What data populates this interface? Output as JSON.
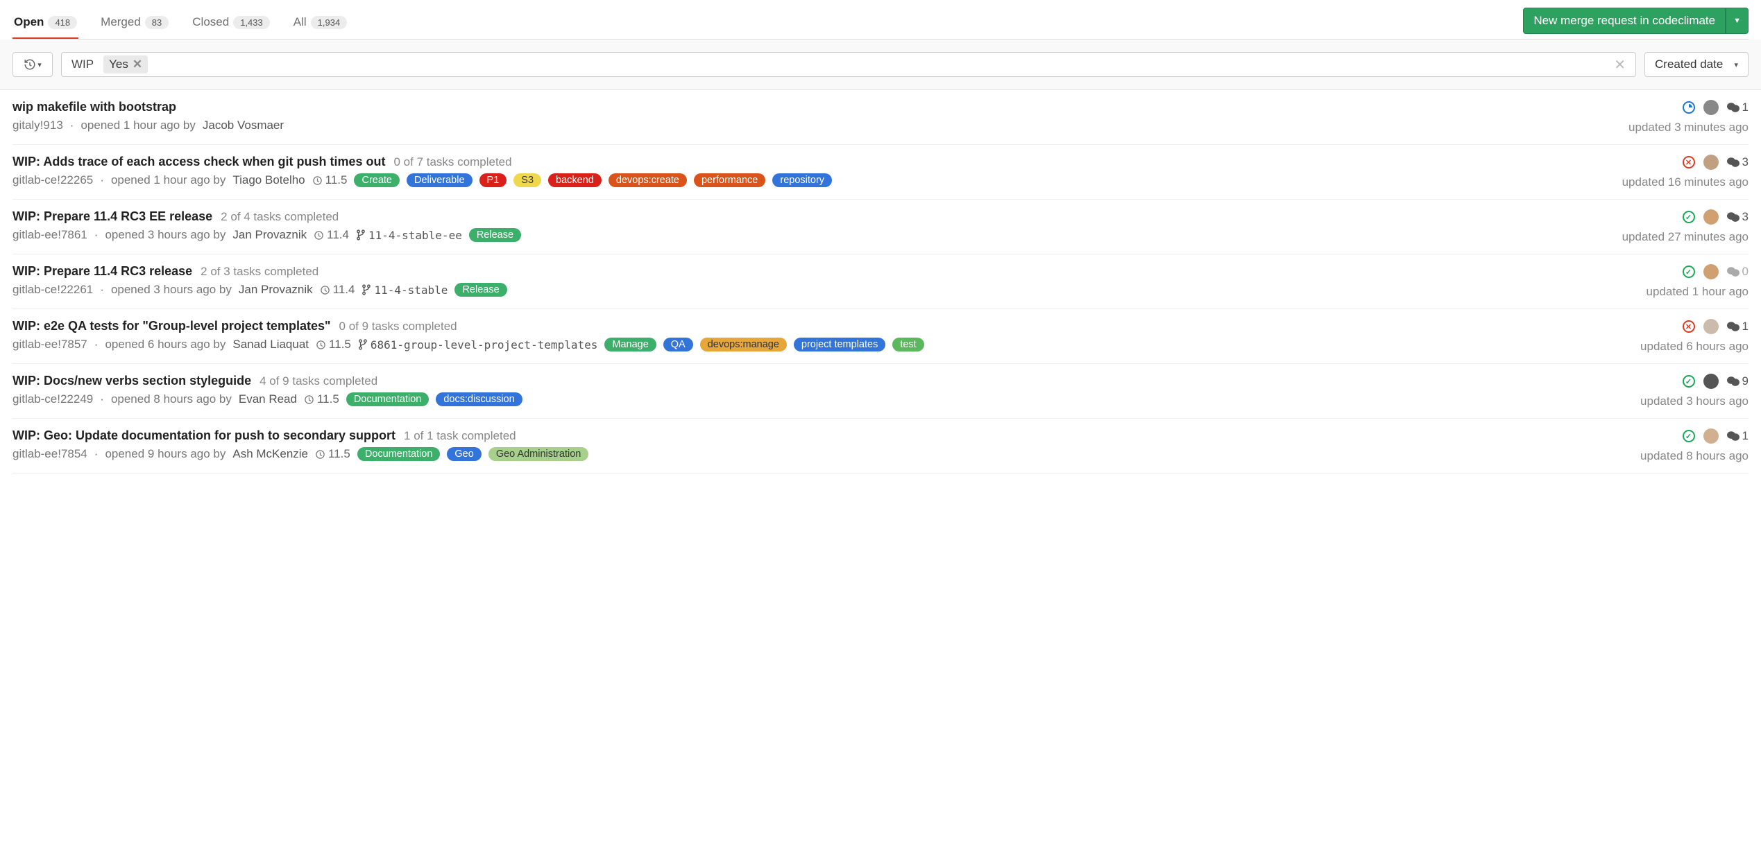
{
  "tabs": {
    "open": {
      "label": "Open",
      "count": "418"
    },
    "merged": {
      "label": "Merged",
      "count": "83"
    },
    "closed": {
      "label": "Closed",
      "count": "1,433"
    },
    "all": {
      "label": "All",
      "count": "1,934"
    }
  },
  "actions": {
    "new_mr": "New merge request in codeclimate"
  },
  "filter": {
    "key": "WIP",
    "value": "Yes"
  },
  "sort": {
    "label": "Created date"
  },
  "items": [
    {
      "title": "wip makefile with bootstrap",
      "tasks": "",
      "ref": "gitaly!913",
      "opened": "opened 1 hour ago by",
      "author": "Jacob Vosmaer",
      "milestone": "",
      "branch": "",
      "labels": [],
      "status": "running",
      "avatar": "#888",
      "comments": "1",
      "comments_muted": false,
      "updated": "updated 3 minutes ago"
    },
    {
      "title": "WIP: Adds trace of each access check when git push times out",
      "tasks": "0 of 7 tasks completed",
      "ref": "gitlab-ce!22265",
      "opened": "opened 1 hour ago by",
      "author": "Tiago Botelho",
      "milestone": "11.5",
      "branch": "",
      "labels": [
        {
          "text": "Create",
          "bg": "#3cb06b"
        },
        {
          "text": "Deliverable",
          "bg": "#3274d9"
        },
        {
          "text": "P1",
          "bg": "#d9211a"
        },
        {
          "text": "S3",
          "bg": "#f0d84c",
          "fg": "#333"
        },
        {
          "text": "backend",
          "bg": "#d9211a"
        },
        {
          "text": "devops:create",
          "bg": "#d9531a"
        },
        {
          "text": "performance",
          "bg": "#d9531a"
        },
        {
          "text": "repository",
          "bg": "#3274d9"
        }
      ],
      "status": "failed",
      "avatar": "#c0a080",
      "comments": "3",
      "comments_muted": false,
      "updated": "updated 16 minutes ago"
    },
    {
      "title": "WIP: Prepare 11.4 RC3 EE release",
      "tasks": "2 of 4 tasks completed",
      "ref": "gitlab-ee!7861",
      "opened": "opened 3 hours ago by",
      "author": "Jan Provaznik",
      "milestone": "11.4",
      "branch": "11-4-stable-ee",
      "labels": [
        {
          "text": "Release",
          "bg": "#3cb06b"
        }
      ],
      "status": "passed",
      "avatar": "#d0a070",
      "comments": "3",
      "comments_muted": false,
      "updated": "updated 27 minutes ago"
    },
    {
      "title": "WIP: Prepare 11.4 RC3 release",
      "tasks": "2 of 3 tasks completed",
      "ref": "gitlab-ce!22261",
      "opened": "opened 3 hours ago by",
      "author": "Jan Provaznik",
      "milestone": "11.4",
      "branch": "11-4-stable",
      "labels": [
        {
          "text": "Release",
          "bg": "#3cb06b"
        }
      ],
      "status": "passed",
      "avatar": "#d0a070",
      "comments": "0",
      "comments_muted": true,
      "updated": "updated 1 hour ago"
    },
    {
      "title": "WIP: e2e QA tests for \"Group-level project templates\"",
      "tasks": "0 of 9 tasks completed",
      "ref": "gitlab-ee!7857",
      "opened": "opened 6 hours ago by",
      "author": "Sanad Liaquat",
      "milestone": "11.5",
      "branch": "6861-group-level-project-templates",
      "labels": [
        {
          "text": "Manage",
          "bg": "#3cb06b"
        },
        {
          "text": "QA",
          "bg": "#3274d9"
        },
        {
          "text": "devops:manage",
          "bg": "#e6a63a",
          "fg": "#333"
        },
        {
          "text": "project templates",
          "bg": "#3274d9"
        },
        {
          "text": "test",
          "bg": "#5cb85c"
        }
      ],
      "status": "failed",
      "avatar": "#cba",
      "comments": "1",
      "comments_muted": false,
      "updated": "updated 6 hours ago"
    },
    {
      "title": "WIP: Docs/new verbs section styleguide",
      "tasks": "4 of 9 tasks completed",
      "ref": "gitlab-ce!22249",
      "opened": "opened 8 hours ago by",
      "author": "Evan Read",
      "milestone": "11.5",
      "branch": "",
      "labels": [
        {
          "text": "Documentation",
          "bg": "#3cb06b"
        },
        {
          "text": "docs:discussion",
          "bg": "#3274d9"
        }
      ],
      "status": "passed",
      "avatar": "#555",
      "comments": "9",
      "comments_muted": false,
      "updated": "updated 3 hours ago"
    },
    {
      "title": "WIP: Geo: Update documentation for push to secondary support",
      "tasks": "1 of 1 task completed",
      "ref": "gitlab-ee!7854",
      "opened": "opened 9 hours ago by",
      "author": "Ash McKenzie",
      "milestone": "11.5",
      "branch": "",
      "labels": [
        {
          "text": "Documentation",
          "bg": "#3cb06b"
        },
        {
          "text": "Geo",
          "bg": "#3274d9"
        },
        {
          "text": "Geo Administration",
          "bg": "#a8d08d",
          "fg": "#333"
        }
      ],
      "status": "passed",
      "avatar": "#d0b090",
      "comments": "1",
      "comments_muted": false,
      "updated": "updated 8 hours ago"
    }
  ]
}
